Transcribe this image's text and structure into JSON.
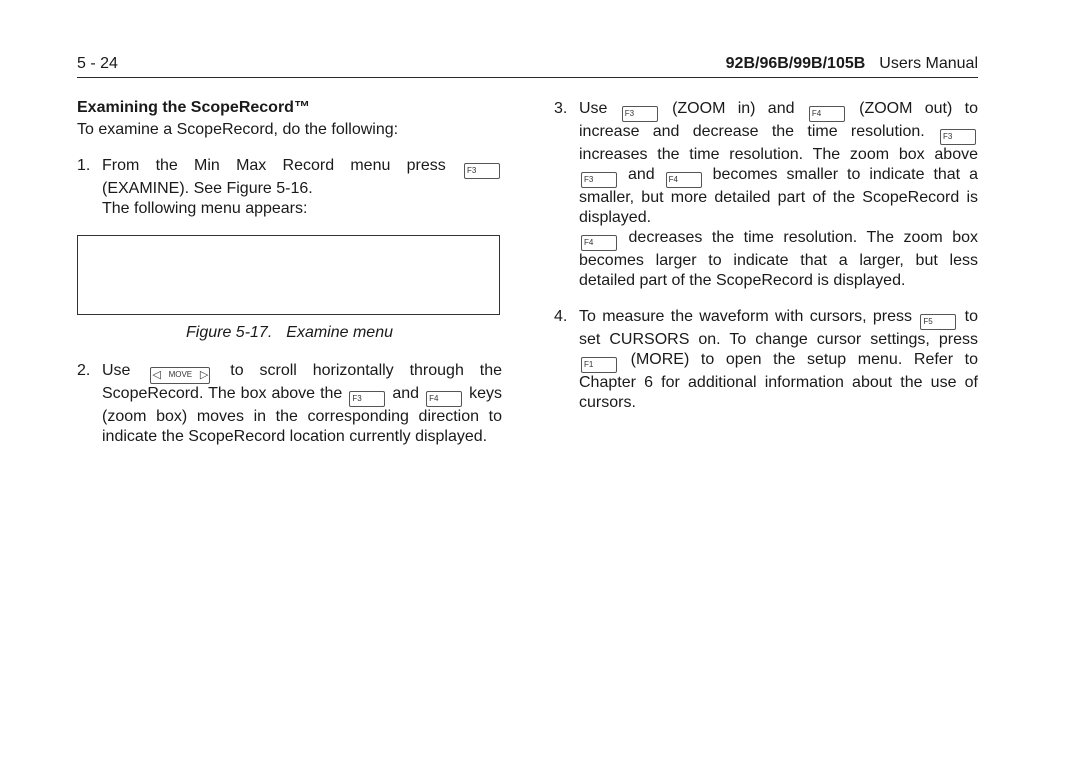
{
  "header": {
    "page_number": "5 - 24",
    "models": "92B/96B/99B/105B",
    "manual": "Users Manual"
  },
  "section": {
    "heading": "Examining the ScopeRecord™",
    "intro": "To examine a ScopeRecord, do the following:"
  },
  "keys": {
    "f1": "F1",
    "f3": "F3",
    "f4": "F4",
    "f5": "F5",
    "move": "MOVE",
    "left_arrow": "◁",
    "right_arrow": "▷"
  },
  "steps": [
    {
      "num": "1.",
      "parts": {
        "a": "From the Min Max Record menu press",
        "b": "(EXAMINE). See Figure 5-16.",
        "c": "The following menu appears:"
      }
    },
    {
      "num": "2.",
      "parts": {
        "a": "Use",
        "b": "to scroll horizontally through the ScopeRecord. The box above the",
        "c": "and",
        "d": "keys (zoom box) moves in the corresponding direction to indicate the ScopeRecord location currently displayed."
      }
    },
    {
      "num": "3.",
      "parts": {
        "a": "Use",
        "b": "(ZOOM in) and",
        "c": "(ZOOM out) to increase and decrease the time resolution.",
        "d": "increases the time resolution. The zoom box above",
        "e": "and",
        "f": "becomes smaller to indicate that a smaller, but more detailed part of the ScopeRecord is displayed.",
        "g": "decreases the time resolution. The zoom box becomes larger to indicate that a larger, but less detailed part of the ScopeRecord is displayed."
      }
    },
    {
      "num": "4.",
      "parts": {
        "a": "To measure the waveform with cursors, press",
        "b": "to set CURSORS on. To change cursor settings, press",
        "c": "(MORE) to open the setup menu. Refer to Chapter 6 for additional information about the use of cursors."
      }
    }
  ],
  "figure": {
    "number": "Figure 5-17.",
    "title": "Examine menu"
  }
}
